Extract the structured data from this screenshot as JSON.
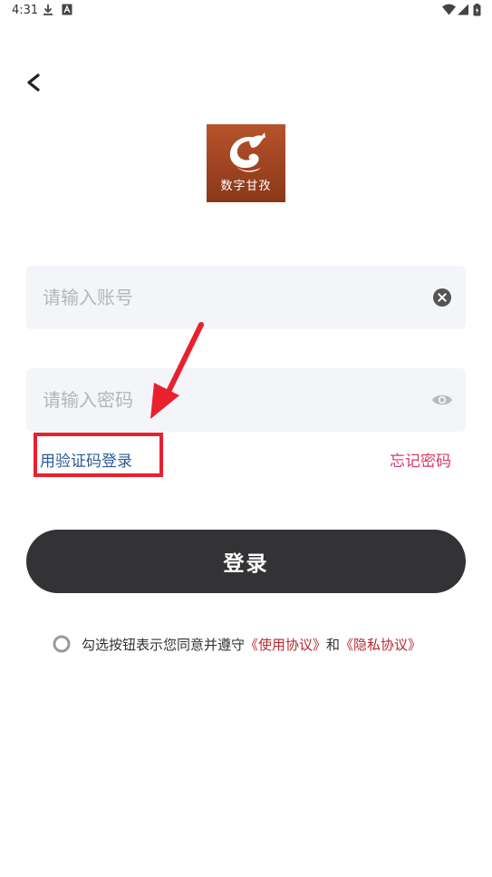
{
  "status_bar": {
    "time": "4:31",
    "icons": [
      "download-icon",
      "a-notification-icon",
      "wifi-icon",
      "signal-icon",
      "battery-icon"
    ]
  },
  "header": {
    "back_icon": "chevron-left-icon"
  },
  "logo": {
    "text": "数字甘孜",
    "brand_color": "#a54a24"
  },
  "form": {
    "account_placeholder": "请输入账号",
    "account_value": "",
    "password_placeholder": "请输入密码",
    "password_value": "",
    "code_login_label": "用验证码登录",
    "forgot_password_label": "忘记密码",
    "login_button_label": "登录"
  },
  "agreement": {
    "prefix": "勾选按钮表示您同意并遵守",
    "terms_link": "《使用协议》",
    "conjunction": "和",
    "privacy_link": "《隐私协议》",
    "checked": false
  },
  "colors": {
    "input_bg": "#f4f5f9",
    "button_bg": "#333336",
    "link_blue": "#2a5b9a",
    "link_pink": "#d63a66",
    "link_red": "#b52a2f",
    "annotation_red": "#e8212f"
  }
}
